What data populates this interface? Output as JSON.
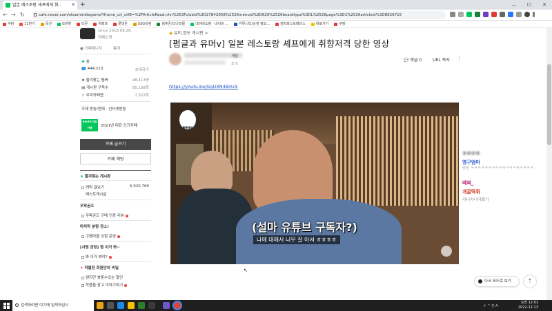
{
  "browser": {
    "tab_title": "일본 레스토랑 세프에게 취..",
    "url": "cafe.naver.com/steamindiegame?iframe_url_utf8=%2FArticleRead.nhn%253Fclubid%3D27842958%2526menuid%3D626%2526boardtype%3DL%2526page%3D1%2526articleid%3D8826715",
    "bookmarks": [
      "쿠팡",
      "11번가",
      "옥션",
      "G마켓",
      "티몬",
      "위메프",
      "롯데온",
      "SSG닷컴",
      "컴퓨존/다나와몰",
      "네이버쇼핑 · 네이버 ...",
      "커뮤니티/상점 정보...",
      "암퍼파스트페이스",
      "바로가기",
      "쿠팡"
    ]
  },
  "sidebar": {
    "since": "since 2018.08.28.",
    "cafe_info": "카페소개",
    "stats_tab": "통계",
    "grade": "숲",
    "members": "444,213",
    "invite": "초대하기",
    "favorite_label": "즐겨찾는 멤버",
    "favorite_count": "48,413명",
    "subscribe_label": "게시판 구독수",
    "subscribe_count": "85,138회",
    "visit_label": "우리카페앱",
    "visit_count": "7,322회",
    "topic": "주제  방송/연예 · 인터넷방송",
    "award_badge": "NAVER 대표카페",
    "award_text": "2021년 대표 인기카페",
    "write_button": "카페 글쓰기",
    "chat_button": "카페 채팅",
    "popular_title": "즐겨찾는 게시판",
    "board1": "캐릭 글보기",
    "board1_count": "5,920,760",
    "board2": "메스트게시글",
    "sect2": "우왁굳즈",
    "item2": "우왁굳즈 구매 인증 리뷰",
    "sect3": "마치막 분량 관스!",
    "item3": "고멤마을 상점 운영",
    "sect4": "[사령 관장] 형 이거 봐~",
    "item4": "봐 이거 봐야?",
    "sect5": "착물한 회원만의 비밀",
    "item5a": "왠지만 봉툰수있는 할인",
    "item5b": "작품들 광고 이야기하기"
  },
  "article": {
    "category": "유머,정보 게시판 >",
    "title": "[펌글과 유머v] 일본 레스토랑 셰프에게 취향저격 당한 영상",
    "author_level": "개팀",
    "views": "조 0",
    "comments": "댓글 0",
    "url_copy": "URL 복사",
    "link": "https://youtu.be/GgUXN4BiXck",
    "video_badge": "똑똑배이",
    "subtitle_main": "(설마 유튜브 구독자?)",
    "subtitle_sub": "나에 대해서 너무 잘 아셔 ㅎㅎㅎㅎ"
  },
  "chat": {
    "line1": "ㅇㅇㅇㅇ",
    "line2_user": "영구엄마",
    "line2_msg": "앙앙 ㅋㅋㅋㅋㅋㅋㅋㅋㅋㅋㅋㅋㅋㅋㅋㅋㅋㅋ",
    "line3_user": "떼찌_",
    "line4_user": "개굴딱쥐",
    "line4_msg": "라니라니아왔가",
    "colors": {
      "user1": "#1a4fc4",
      "user2": "#c0207a",
      "user3": "#d0301a"
    }
  },
  "controls": {
    "darkmode": "다크 모드로 보기",
    "totop": "⇡"
  },
  "taskbar": {
    "search": "검색하려면 여기에 입력하십시",
    "time": "오전 12:01",
    "date": "2022-12-13",
    "tray": "ㅇ ^ 한 A"
  },
  "colors": {
    "naver_green": "#03c75a",
    "link_blue": "#1a4fc4",
    "dark_button": "#484848"
  }
}
